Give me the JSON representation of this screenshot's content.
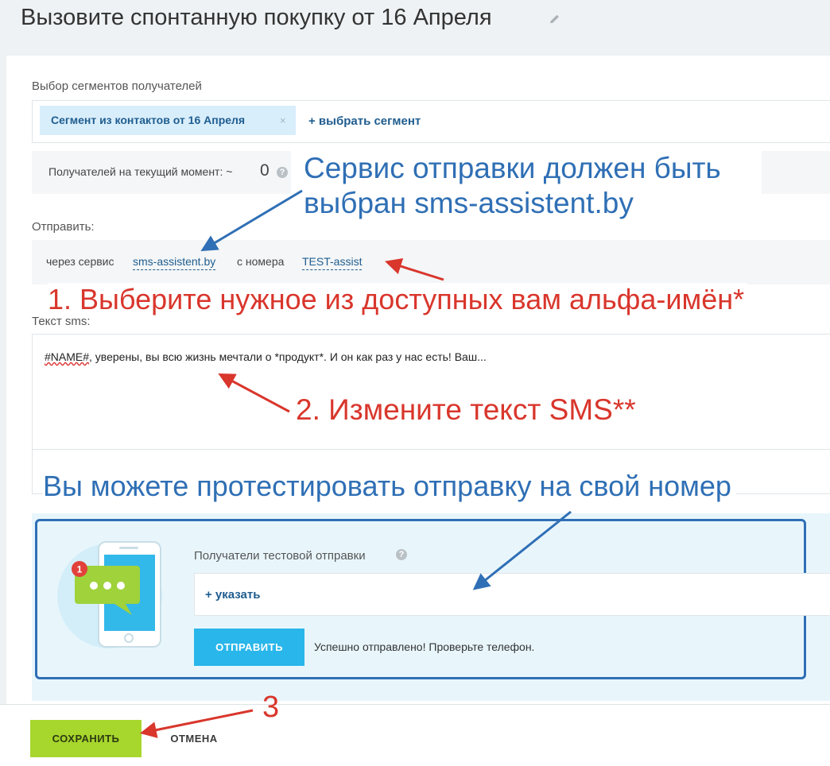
{
  "header": {
    "title": "Вызовите спонтанную покупку от 16 Апреля"
  },
  "segments": {
    "label": "Выбор сегментов получателей",
    "selected_tag": "Сегмент из контактов от 16 Апреля",
    "remove_symbol": "×",
    "add_label": "+ выбрать сегмент"
  },
  "recipients": {
    "label": "Получателей на текущий момент: ~",
    "count": "0",
    "help_symbol": "?"
  },
  "send": {
    "label": "Отправить:",
    "via_text": "через сервис",
    "service": "sms-assistent.by",
    "from_text": "с номера",
    "sender": "TEST-assist"
  },
  "sms": {
    "label": "Текст sms:",
    "text_var": "#NAME#",
    "text_rest": ", уверены, вы всю жизнь мечтали о *продукт*. И он как раз у нас есть! Ваш..."
  },
  "test_send": {
    "label": "Получатели тестовой отправки",
    "help_symbol": "?",
    "add_label": "+ указать",
    "button": "ОТПРАВИТЬ",
    "status": "Успешно отправлено! Проверьте телефон.",
    "badge": "1"
  },
  "footer": {
    "save": "СОХРАНИТЬ",
    "cancel": "ОТМЕНА"
  },
  "annotations": {
    "service_note_line1": "Сервис отправки должен быть",
    "service_note_line2": "выбран sms-assistent.by",
    "step1": "1. Выберите нужное из доступных вам альфа-имён*",
    "step2": "2. Измените текст SMS**",
    "test_note": "Вы можете протестировать отправку на свой номер",
    "step3": "3"
  },
  "colors": {
    "accent_blue": "#2f6fb5",
    "annotation_red": "#d9362c",
    "send_button": "#29b6ea",
    "save_button": "#a7d62c",
    "tag_bg": "#d9eefb"
  },
  "icons": [
    "pencil-icon",
    "help-icon",
    "phone-sms-icon",
    "chat-bubble-icon"
  ]
}
